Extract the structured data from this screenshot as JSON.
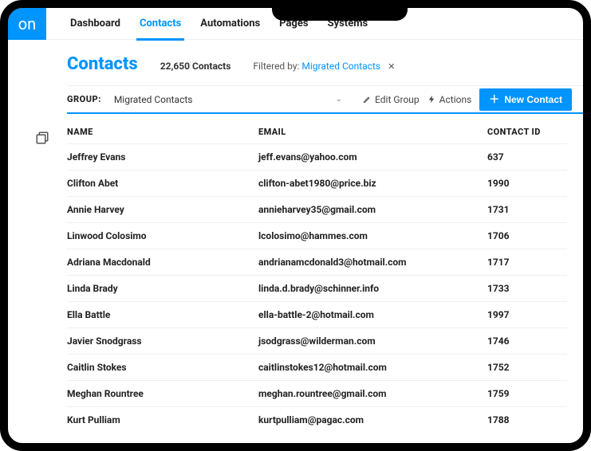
{
  "brand": "on",
  "nav": {
    "items": [
      {
        "label": "Dashboard",
        "active": false
      },
      {
        "label": "Contacts",
        "active": true
      },
      {
        "label": "Automations",
        "active": false
      },
      {
        "label": "Pages",
        "active": false
      },
      {
        "label": "Systems",
        "active": false
      }
    ]
  },
  "header": {
    "title": "Contacts",
    "count_text": "22,650 Contacts",
    "filtered_prefix": "Filtered by:",
    "filter_name": "Migrated Contacts"
  },
  "groupbar": {
    "label": "GROUP:",
    "selected": "Migrated Contacts",
    "edit_label": "Edit Group",
    "actions_label": "Actions",
    "new_contact_label": "New Contact"
  },
  "table": {
    "columns": {
      "name": "NAME",
      "email": "EMAIL",
      "id": "CONTACT ID"
    },
    "rows": [
      {
        "name": "Jeffrey Evans",
        "email": "jeff.evans@yahoo.com",
        "id": "637"
      },
      {
        "name": "Clifton Abet",
        "email": "clifton-abet1980@price.biz",
        "id": "1990"
      },
      {
        "name": "Annie Harvey",
        "email": "annieharvey35@gmail.com",
        "id": "1731"
      },
      {
        "name": "Linwood Colosimo",
        "email": "lcolosimo@hammes.com",
        "id": "1706"
      },
      {
        "name": "Adriana Macdonald",
        "email": "andrianamcdonald3@hotmail.com",
        "id": "1717"
      },
      {
        "name": "Linda Brady",
        "email": "linda.d.brady@schinner.info",
        "id": "1733"
      },
      {
        "name": "Ella Battle",
        "email": "ella-battle-2@hotmail.com",
        "id": "1997"
      },
      {
        "name": "Javier Snodgrass",
        "email": "jsodgrass@wilderman.com",
        "id": "1746"
      },
      {
        "name": "Caitlin Stokes",
        "email": "caitlinstokes12@hotmail.com",
        "id": "1752"
      },
      {
        "name": "Meghan Rountree",
        "email": "meghan.rountree@gmail.com",
        "id": "1759"
      },
      {
        "name": "Kurt Pulliam",
        "email": "kurtpulliam@pagac.com",
        "id": "1788"
      }
    ]
  }
}
